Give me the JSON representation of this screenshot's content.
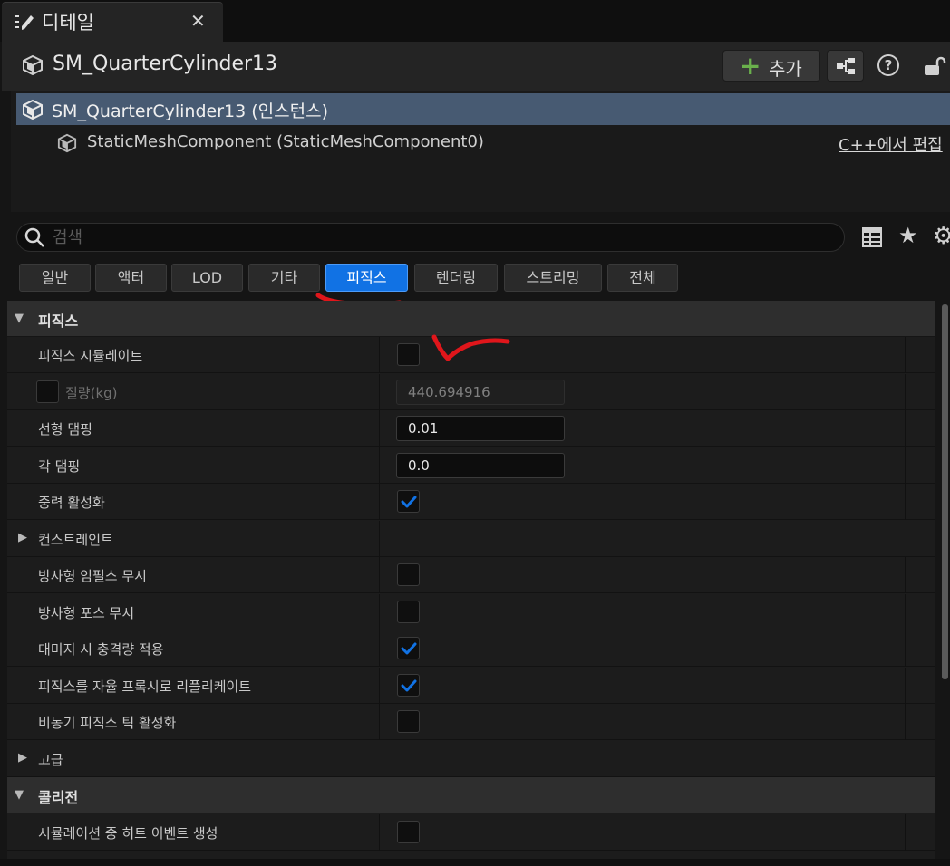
{
  "tab": {
    "title": "디테일",
    "close": "✕"
  },
  "header": {
    "actor_name": "SM_QuarterCylinder13",
    "add_label": "추가",
    "help": "?"
  },
  "tree": {
    "selected_label": "SM_QuarterCylinder13 (인스턴스)",
    "child_label": "StaticMeshComponent (StaticMeshComponent0)",
    "edit_cpp": "C++에서 편집"
  },
  "search": {
    "placeholder": "검색",
    "value": ""
  },
  "categories": [
    "일반",
    "액터",
    "LOD",
    "기타",
    "피직스",
    "렌더링",
    "스트리밍",
    "전체"
  ],
  "active_category": "피직스",
  "physics": {
    "section_title": "피직스",
    "simulate_label": "피직스 시뮬레이트",
    "simulate_checked": false,
    "mass_label": "질량(kg)",
    "mass_override_checked": false,
    "mass_value": "440.694916",
    "linear_damping_label": "선형 댐핑",
    "linear_damping_value": "0.01",
    "angular_damping_label": "각 댐핑",
    "angular_damping_value": "0.0",
    "gravity_label": "중력 활성화",
    "gravity_checked": true,
    "constraints_label": "컨스트레인트",
    "ignore_radial_impulse_label": "방사형 임펄스 무시",
    "ignore_radial_impulse_checked": false,
    "ignore_radial_force_label": "방사형 포스 무시",
    "ignore_radial_force_checked": false,
    "apply_impulse_on_damage_label": "대미지 시 충격량 적용",
    "apply_impulse_on_damage_checked": true,
    "replicate_physics_label": "피직스를 자율 프록시로 리플리케이트",
    "replicate_physics_checked": true,
    "async_tick_label": "비동기 피직스 틱 활성화",
    "async_tick_checked": false,
    "advanced_label": "고급"
  },
  "collision": {
    "section_title": "콜리전",
    "hit_events_label": "시뮬레이션 중 히트 이벤트 생성",
    "hit_events_checked": false
  },
  "colors": {
    "accent": "#1172e4",
    "selection": "#475a72",
    "annotation": "#e0161b",
    "plus": "#6ab04c"
  }
}
